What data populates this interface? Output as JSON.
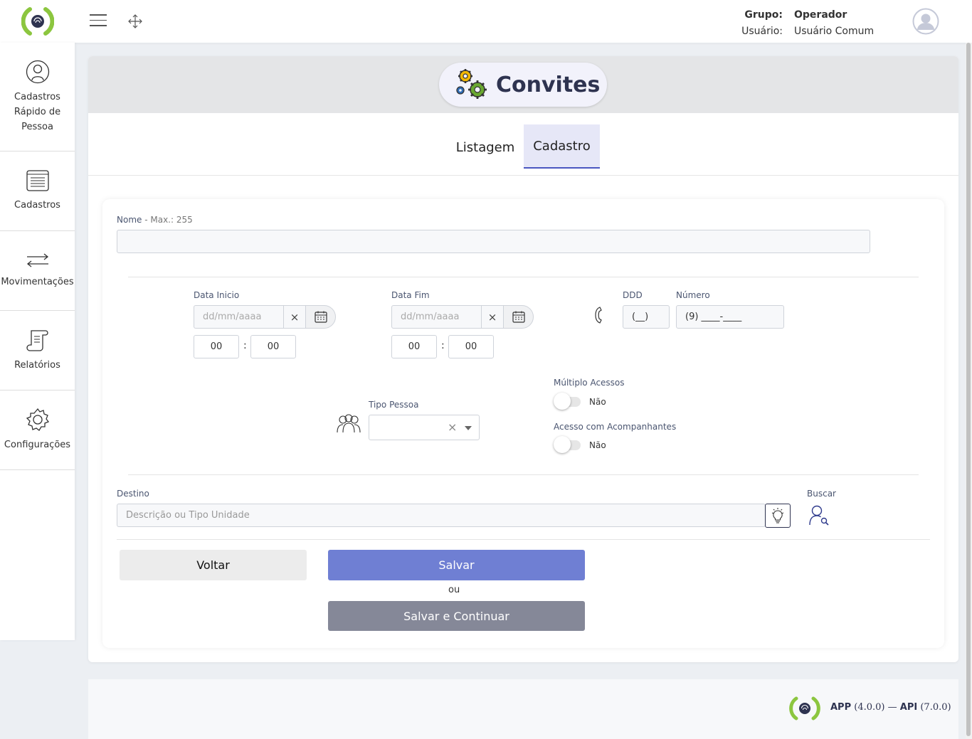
{
  "header": {
    "group_label": "Grupo:",
    "group_value": "Operador",
    "user_label": "Usuário:",
    "user_value": "Usuário Comum"
  },
  "sidebar": {
    "items": [
      {
        "label": "Cadastros Rápido de Pessoa",
        "icon": "person-circle-icon"
      },
      {
        "label": "Cadastros",
        "icon": "list-document-icon"
      },
      {
        "label": "Movimentações",
        "icon": "arrows-exchange-icon"
      },
      {
        "label": "Relatórios",
        "icon": "scroll-report-icon"
      },
      {
        "label": "Configurações",
        "icon": "gear-icon"
      }
    ]
  },
  "page": {
    "title": "Convites",
    "tabs": [
      {
        "label": "Listagem",
        "active": false
      },
      {
        "label": "Cadastro",
        "active": true
      }
    ]
  },
  "form": {
    "nome_label": "Nome",
    "nome_hint": "- Max.: 255",
    "nome_value": "",
    "data_inicio_label": "Data Inicio",
    "data_inicio_placeholder": "dd/mm/aaaa",
    "data_inicio_hour": "00",
    "data_inicio_minute": "00",
    "data_fim_label": "Data Fim",
    "data_fim_placeholder": "dd/mm/aaaa",
    "data_fim_hour": "00",
    "data_fim_minute": "00",
    "time_separator": ":",
    "clear_glyph": "×",
    "ddd_label": "DDD",
    "ddd_value": "(__)",
    "numero_label": "Número",
    "numero_value": "(9) ____-____",
    "multiplo_label": "Múltiplo Acessos",
    "multiplo_value": "Não",
    "acompanhantes_label": "Acesso com Acompanhantes",
    "acompanhantes_value": "Não",
    "tipo_pessoa_label": "Tipo Pessoa",
    "tipo_pessoa_value": "",
    "destino_label": "Destino",
    "destino_placeholder": "Descrição ou Tipo Unidade",
    "buscar_label": "Buscar"
  },
  "actions": {
    "voltar": "Voltar",
    "salvar": "Salvar",
    "ou": "ou",
    "salvar_continuar": "Salvar e Continuar"
  },
  "footer": {
    "app_label": "APP",
    "app_version": "(4.0.0)",
    "separator": "—",
    "api_label": "API",
    "api_version": "(7.0.0)"
  },
  "colors": {
    "brand_green": "#8cc63f",
    "brand_navy": "#2e3350",
    "primary": "#6f7fd3",
    "secondary": "#858898"
  }
}
